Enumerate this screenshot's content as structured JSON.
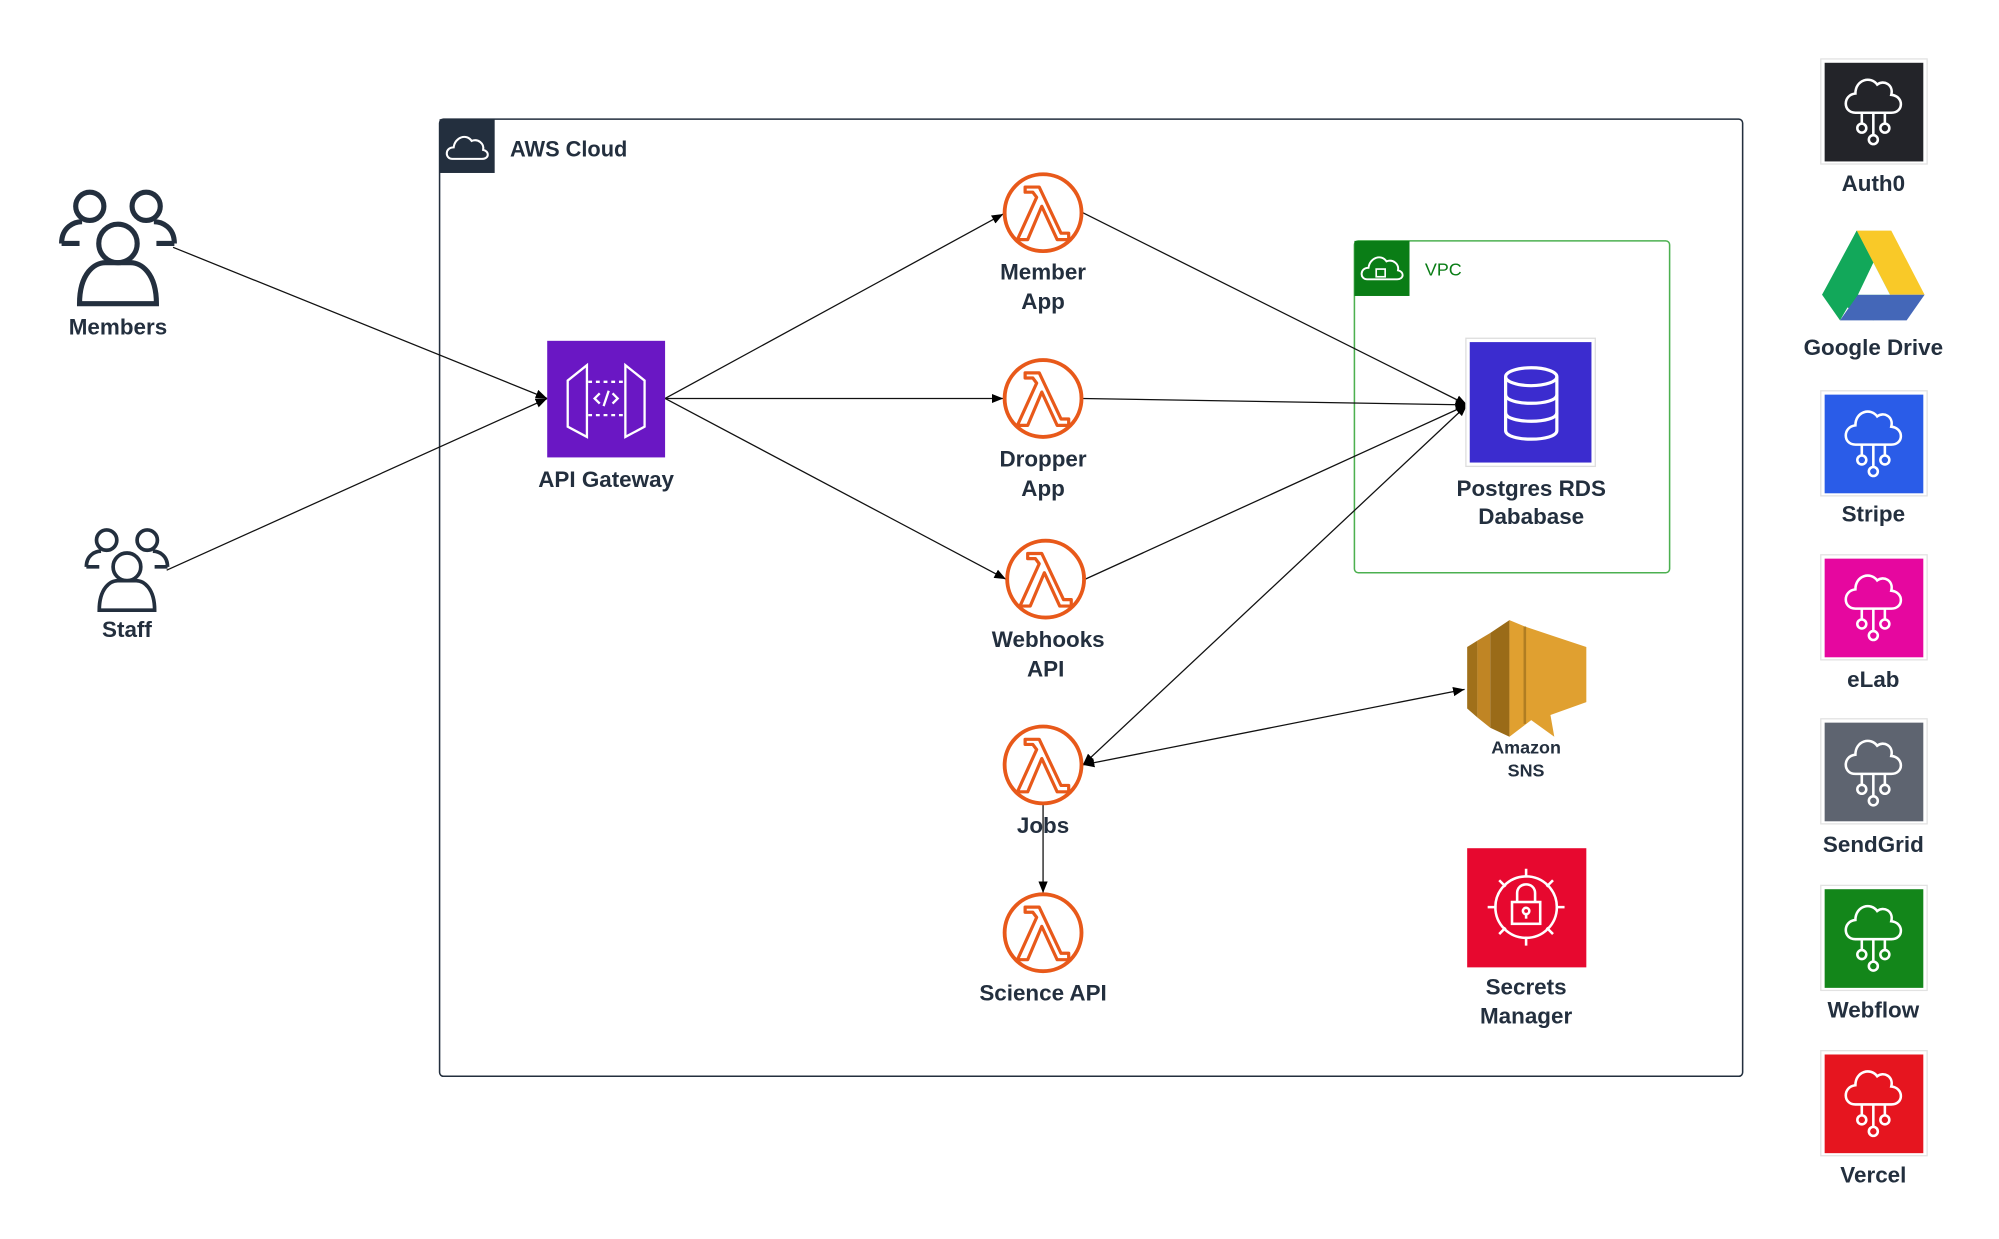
{
  "colors": {
    "aws_dark": "#232f3e",
    "lambda": "#e8591a",
    "api_gateway": "#6a17c4",
    "rds": "#3b2ccf",
    "vpc": "#0a7d16",
    "vpc_border": "#4cb050",
    "sns": "#e0a030",
    "secrets": "#e7082f",
    "auth0": "#232429",
    "stripe": "#2a5ce8",
    "elab": "#e6079f",
    "sendgrid": "#5e6470",
    "webflow": "#13861a",
    "vercel": "#e6151f"
  },
  "actors": [
    {
      "label": "Members",
      "icon": "users-icon"
    },
    {
      "label": "Staff",
      "icon": "users-icon"
    }
  ],
  "aws_cloud": {
    "title": "AWS Cloud",
    "icon": "cloud-icon"
  },
  "vpc": {
    "title": "VPC",
    "icon": "cloud-lock-icon"
  },
  "api_gateway": {
    "label": "API Gateway",
    "icon": "api-gateway-icon"
  },
  "lambdas": [
    {
      "label": [
        "Member",
        "App"
      ]
    },
    {
      "label": [
        "Dropper",
        "App"
      ]
    },
    {
      "label": [
        "Webhooks",
        "API"
      ]
    },
    {
      "label": [
        "Jobs"
      ]
    },
    {
      "label": [
        "Science API"
      ]
    }
  ],
  "rds": {
    "label": [
      "Postgres RDS",
      "Dababase"
    ],
    "icon": "database-icon"
  },
  "sns": {
    "label": [
      "Amazon",
      "SNS"
    ],
    "icon": "sns-icon"
  },
  "secrets": {
    "label": [
      "Secrets",
      "Manager"
    ],
    "icon": "secrets-lock-icon"
  },
  "external_services": [
    {
      "label": "Auth0",
      "icon": "cloud-network-icon"
    },
    {
      "label": "Google Drive",
      "icon": "google-drive-icon"
    },
    {
      "label": "Stripe",
      "icon": "cloud-network-icon"
    },
    {
      "label": "eLab",
      "icon": "cloud-network-icon"
    },
    {
      "label": "SendGrid",
      "icon": "cloud-network-icon"
    },
    {
      "label": "Webflow",
      "icon": "cloud-network-icon"
    },
    {
      "label": "Vercel",
      "icon": "cloud-network-icon"
    }
  ],
  "edges": [
    {
      "from": "Members",
      "to": "API Gateway"
    },
    {
      "from": "Staff",
      "to": "API Gateway"
    },
    {
      "from": "API Gateway",
      "to": "Member App"
    },
    {
      "from": "API Gateway",
      "to": "Dropper App"
    },
    {
      "from": "API Gateway",
      "to": "Webhooks API"
    },
    {
      "from": "Member App",
      "to": "Postgres RDS Dababase"
    },
    {
      "from": "Dropper App",
      "to": "Postgres RDS Dababase"
    },
    {
      "from": "Webhooks API",
      "to": "Postgres RDS Dababase"
    },
    {
      "from": "Jobs",
      "to": "Postgres RDS Dababase",
      "bidirectional": true
    },
    {
      "from": "Jobs",
      "to": "Amazon SNS",
      "bidirectional": true
    },
    {
      "from": "Jobs",
      "to": "Science API"
    }
  ]
}
